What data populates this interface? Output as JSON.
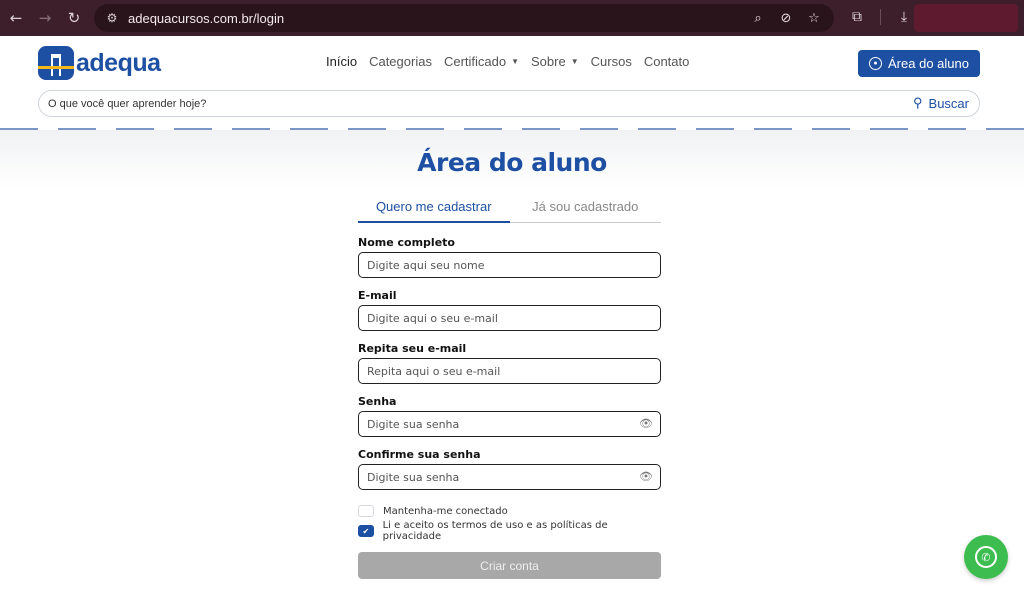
{
  "browser": {
    "url": "adequacursos.com.br/login",
    "icons": {
      "back": "←",
      "forward": "→",
      "reload": "↻",
      "site_settings": "⚙",
      "zoom": "⌕",
      "eye_off": "⊘",
      "star": "☆",
      "extensions": "⧉",
      "download": "⤓"
    }
  },
  "header": {
    "logo_text": "adequa",
    "nav": [
      {
        "label": "Início"
      },
      {
        "label": "Categorias"
      },
      {
        "label": "Certificado"
      },
      {
        "label": "Sobre"
      },
      {
        "label": "Cursos"
      },
      {
        "label": "Contato"
      }
    ],
    "area_button": "Área do aluno",
    "search": {
      "placeholder": "O que você quer aprender hoje?",
      "action": "Buscar"
    }
  },
  "main": {
    "title": "Área do aluno",
    "tabs": [
      {
        "label": "Quero me cadastrar",
        "active": true
      },
      {
        "label": "Já sou cadastrado",
        "active": false
      }
    ],
    "form": {
      "fields": [
        {
          "label": "Nome completo",
          "placeholder": "Digite aqui seu nome",
          "value": ""
        },
        {
          "label": "E-mail",
          "placeholder": "Digite aqui o seu e-mail",
          "value": ""
        },
        {
          "label": "Repita seu e-mail",
          "placeholder": "Repita aqui o seu e-mail",
          "value": ""
        },
        {
          "label": "Senha",
          "placeholder": "Digite sua senha",
          "value": ""
        },
        {
          "label": "Confirme sua senha",
          "placeholder": "Digite sua senha",
          "value": ""
        }
      ],
      "checkboxes": [
        {
          "label": "Mantenha-me conectado",
          "checked": false
        },
        {
          "label": "Li e aceito os termos de uso e as políticas de privacidade",
          "checked": true
        }
      ],
      "submit": "Criar conta"
    }
  },
  "colors": {
    "brand": "#1d4fa3",
    "whatsapp": "#3dbd50",
    "chrome": "#3c1f2a",
    "submit_disabled": "#a8a8a8"
  }
}
